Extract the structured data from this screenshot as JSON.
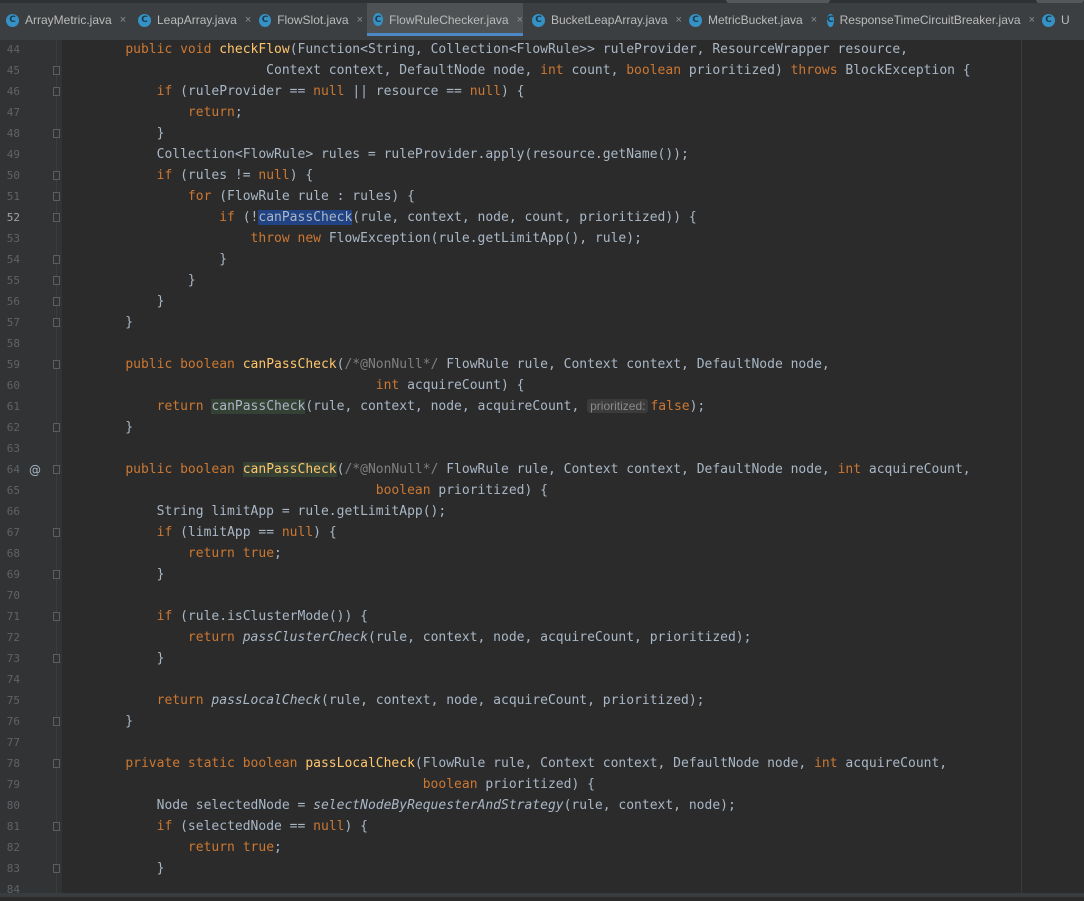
{
  "tabs": [
    {
      "label": "ArrayMetric.java",
      "active": false,
      "has_close": true
    },
    {
      "label": "LeapArray.java",
      "active": false,
      "has_close": true
    },
    {
      "label": "FlowSlot.java",
      "active": false,
      "has_close": true
    },
    {
      "label": "FlowRuleChecker.java",
      "active": true,
      "has_close": true
    },
    {
      "label": "BucketLeapArray.java",
      "active": false,
      "has_close": true
    },
    {
      "label": "MetricBucket.java",
      "active": false,
      "has_close": true
    },
    {
      "label": "ResponseTimeCircuitBreaker.java",
      "active": false,
      "has_close": true
    },
    {
      "label": "U",
      "active": false,
      "has_close": false
    }
  ],
  "tab_icon_letter": "C",
  "close_glyph": "×",
  "gutter_annotation": "@",
  "current_line": "52",
  "lines": [
    {
      "n": "44",
      "fold": false,
      "code": [
        [
          "    ",
          ""
        ],
        [
          "public void ",
          "kw"
        ],
        [
          "checkFlow",
          "fn"
        ],
        [
          "(Function<String, Collection<FlowRule>> ruleProvider, ResourceWrapper resource,",
          ""
        ]
      ]
    },
    {
      "n": "45",
      "fold": true,
      "code": [
        [
          "                      Context context, DefaultNode node, ",
          ""
        ],
        [
          "int ",
          "kw"
        ],
        [
          "count, ",
          ""
        ],
        [
          "boolean ",
          "kw"
        ],
        [
          "prioritized) ",
          ""
        ],
        [
          "throws ",
          "kw"
        ],
        [
          "BlockException {",
          ""
        ]
      ]
    },
    {
      "n": "46",
      "fold": true,
      "code": [
        [
          "        ",
          ""
        ],
        [
          "if ",
          "kw"
        ],
        [
          "(ruleProvider == ",
          ""
        ],
        [
          "null ",
          "kw"
        ],
        [
          "|| resource == ",
          ""
        ],
        [
          "null",
          "kw"
        ],
        [
          ") {",
          ""
        ]
      ]
    },
    {
      "n": "47",
      "fold": false,
      "code": [
        [
          "            ",
          ""
        ],
        [
          "return",
          "kw"
        ],
        [
          ";",
          ""
        ]
      ]
    },
    {
      "n": "48",
      "fold": true,
      "code": [
        [
          "        }",
          ""
        ]
      ]
    },
    {
      "n": "49",
      "fold": false,
      "code": [
        [
          "        Collection<FlowRule> rules = ruleProvider.apply(resource.getName());",
          ""
        ]
      ]
    },
    {
      "n": "50",
      "fold": true,
      "code": [
        [
          "        ",
          ""
        ],
        [
          "if ",
          "kw"
        ],
        [
          "(rules != ",
          ""
        ],
        [
          "null",
          "kw"
        ],
        [
          ") {",
          ""
        ]
      ]
    },
    {
      "n": "51",
      "fold": true,
      "code": [
        [
          "            ",
          ""
        ],
        [
          "for ",
          "kw"
        ],
        [
          "(FlowRule rule : rules) {",
          ""
        ]
      ]
    },
    {
      "n": "52",
      "fold": true,
      "code": [
        [
          "                ",
          ""
        ],
        [
          "if ",
          "kw"
        ],
        [
          "(!",
          ""
        ],
        [
          "canPassCheck",
          "hl-sel"
        ],
        [
          "(rule, context, node, count, prioritized)) {",
          ""
        ]
      ]
    },
    {
      "n": "53",
      "fold": false,
      "code": [
        [
          "                    ",
          ""
        ],
        [
          "throw new ",
          "kw"
        ],
        [
          "FlowException(rule.getLimitApp(), rule);",
          ""
        ]
      ]
    },
    {
      "n": "54",
      "fold": true,
      "code": [
        [
          "                }",
          ""
        ]
      ]
    },
    {
      "n": "55",
      "fold": true,
      "code": [
        [
          "            }",
          ""
        ]
      ]
    },
    {
      "n": "56",
      "fold": true,
      "code": [
        [
          "        }",
          ""
        ]
      ]
    },
    {
      "n": "57",
      "fold": true,
      "code": [
        [
          "    }",
          ""
        ]
      ]
    },
    {
      "n": "58",
      "fold": false,
      "code": []
    },
    {
      "n": "59",
      "fold": true,
      "code": [
        [
          "    ",
          ""
        ],
        [
          "public boolean ",
          "kw"
        ],
        [
          "canPassCheck",
          "fn"
        ],
        [
          "(",
          ""
        ],
        [
          "/*",
          "cm"
        ],
        [
          "@NonNull",
          "cm"
        ],
        [
          "*/ ",
          "cm"
        ],
        [
          "FlowRule rule, Context context, DefaultNode node,",
          ""
        ]
      ]
    },
    {
      "n": "60",
      "fold": false,
      "code": [
        [
          "                                    ",
          ""
        ],
        [
          "int ",
          "kw"
        ],
        [
          "acquireCount) {",
          ""
        ]
      ]
    },
    {
      "n": "61",
      "fold": false,
      "code": [
        [
          "        ",
          ""
        ],
        [
          "return ",
          "kw"
        ],
        [
          "canPassCheck",
          "hl-use"
        ],
        [
          "(rule, context, node, acquireCount, ",
          ""
        ],
        [
          "prioritized:",
          "hint"
        ],
        [
          "false",
          "kw"
        ],
        [
          ");",
          ""
        ]
      ]
    },
    {
      "n": "62",
      "fold": true,
      "code": [
        [
          "    }",
          ""
        ]
      ]
    },
    {
      "n": "63",
      "fold": false,
      "code": []
    },
    {
      "n": "64",
      "fold": true,
      "at": true,
      "code": [
        [
          "    ",
          ""
        ],
        [
          "public boolean ",
          "kw"
        ],
        [
          "canPassCheck",
          "fn hl-use"
        ],
        [
          "(",
          ""
        ],
        [
          "/*",
          "cm"
        ],
        [
          "@NonNull",
          "cm"
        ],
        [
          "*/ ",
          "cm"
        ],
        [
          "FlowRule rule, Context context, DefaultNode node, ",
          ""
        ],
        [
          "int ",
          "kw"
        ],
        [
          "acquireCount,",
          ""
        ]
      ]
    },
    {
      "n": "65",
      "fold": false,
      "code": [
        [
          "                                    ",
          ""
        ],
        [
          "boolean ",
          "kw"
        ],
        [
          "prioritized) {",
          ""
        ]
      ]
    },
    {
      "n": "66",
      "fold": false,
      "code": [
        [
          "        String limitApp = rule.getLimitApp();",
          ""
        ]
      ]
    },
    {
      "n": "67",
      "fold": true,
      "code": [
        [
          "        ",
          ""
        ],
        [
          "if ",
          "kw"
        ],
        [
          "(limitApp == ",
          ""
        ],
        [
          "null",
          "kw"
        ],
        [
          ") {",
          ""
        ]
      ]
    },
    {
      "n": "68",
      "fold": false,
      "code": [
        [
          "            ",
          ""
        ],
        [
          "return true",
          "kw"
        ],
        [
          ";",
          ""
        ]
      ]
    },
    {
      "n": "69",
      "fold": true,
      "code": [
        [
          "        }",
          ""
        ]
      ]
    },
    {
      "n": "70",
      "fold": false,
      "code": []
    },
    {
      "n": "71",
      "fold": true,
      "code": [
        [
          "        ",
          ""
        ],
        [
          "if ",
          "kw"
        ],
        [
          "(rule.isClusterMode()) {",
          ""
        ]
      ]
    },
    {
      "n": "72",
      "fold": false,
      "code": [
        [
          "            ",
          ""
        ],
        [
          "return ",
          "kw"
        ],
        [
          "passClusterCheck",
          "it"
        ],
        [
          "(rule, context, node, acquireCount, prioritized);",
          ""
        ]
      ]
    },
    {
      "n": "73",
      "fold": true,
      "code": [
        [
          "        }",
          ""
        ]
      ]
    },
    {
      "n": "74",
      "fold": false,
      "code": []
    },
    {
      "n": "75",
      "fold": false,
      "code": [
        [
          "        ",
          ""
        ],
        [
          "return ",
          "kw"
        ],
        [
          "passLocalCheck",
          "it"
        ],
        [
          "(rule, context, node, acquireCount, prioritized);",
          ""
        ]
      ]
    },
    {
      "n": "76",
      "fold": true,
      "code": [
        [
          "    }",
          ""
        ]
      ]
    },
    {
      "n": "77",
      "fold": false,
      "code": []
    },
    {
      "n": "78",
      "fold": true,
      "code": [
        [
          "    ",
          ""
        ],
        [
          "private static boolean ",
          "kw"
        ],
        [
          "passLocalCheck",
          "fn"
        ],
        [
          "(FlowRule rule, Context context, DefaultNode node, ",
          ""
        ],
        [
          "int ",
          "kw"
        ],
        [
          "acquireCount,",
          ""
        ]
      ]
    },
    {
      "n": "79",
      "fold": false,
      "code": [
        [
          "                                          ",
          ""
        ],
        [
          "boolean ",
          "kw"
        ],
        [
          "prioritized) {",
          ""
        ]
      ]
    },
    {
      "n": "80",
      "fold": false,
      "code": [
        [
          "        Node selectedNode = ",
          ""
        ],
        [
          "selectNodeByRequesterAndStrategy",
          "it"
        ],
        [
          "(rule, context, node);",
          ""
        ]
      ]
    },
    {
      "n": "81",
      "fold": true,
      "code": [
        [
          "        ",
          ""
        ],
        [
          "if ",
          "kw"
        ],
        [
          "(selectedNode == ",
          ""
        ],
        [
          "null",
          "kw"
        ],
        [
          ") {",
          ""
        ]
      ]
    },
    {
      "n": "82",
      "fold": false,
      "code": [
        [
          "            ",
          ""
        ],
        [
          "return true",
          "kw"
        ],
        [
          ";",
          ""
        ]
      ]
    },
    {
      "n": "83",
      "fold": true,
      "code": [
        [
          "        }",
          ""
        ]
      ]
    },
    {
      "n": "84",
      "fold": false,
      "code": []
    }
  ]
}
